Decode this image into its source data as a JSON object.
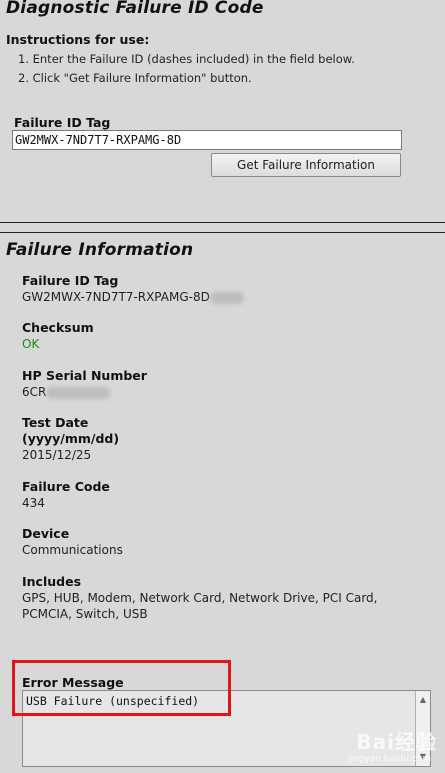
{
  "diagnostic": {
    "title": "Diagnostic Failure ID Code",
    "instructions_head": "Instructions for use:",
    "instructions": [
      "1. Enter the Failure ID (dashes included) in the field below.",
      "2. Click \"Get Failure Information\" button."
    ],
    "tag_label": "Failure ID Tag",
    "tag_value": "GW2MWX-7ND7T7-RXPAMG-8D",
    "button_label": "Get Failure Information"
  },
  "failure_info": {
    "title": "Failure Information",
    "fields": {
      "failure_id_tag": {
        "label": "Failure ID Tag",
        "value": "GW2MWX-7ND7T7-RXPAMG-8D"
      },
      "checksum": {
        "label": "Checksum",
        "value": "OK"
      },
      "serial": {
        "label": "HP Serial Number",
        "value": "6CR"
      },
      "test_date": {
        "label_line1": "Test Date",
        "label_line2": "(yyyy/mm/dd)",
        "value": "2015/12/25"
      },
      "failure_code": {
        "label": "Failure Code",
        "value": "434"
      },
      "device": {
        "label": "Device",
        "value": "Communications"
      },
      "includes": {
        "label": "Includes",
        "value_line1": "GPS, HUB, Modem, Network Card, Network Drive, PCI Card,",
        "value_line2": "PCMCIA, Switch, USB"
      },
      "error_message": {
        "label": "Error Message",
        "value": "USB Failure (unspecified)"
      }
    }
  },
  "watermark": {
    "brand": "Bai经验",
    "url": "jingyan.baidu.com"
  },
  "colors": {
    "background": "#d8d8d8",
    "ok_green": "#1a8a1a",
    "highlight_red": "#e8121a"
  }
}
